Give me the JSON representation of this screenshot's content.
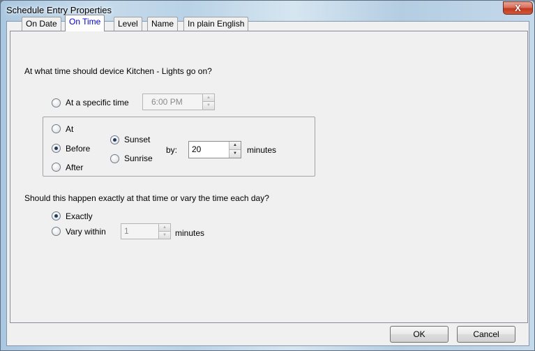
{
  "window": {
    "title": "Schedule Entry Properties",
    "close_glyph": "X"
  },
  "tabs": [
    {
      "label": "On Date",
      "active": false
    },
    {
      "label": "On Time",
      "active": true
    },
    {
      "label": "Level",
      "active": false
    },
    {
      "label": "Name",
      "active": false
    },
    {
      "label": "In plain English",
      "active": false
    }
  ],
  "on_time": {
    "question": "At what time should device Kitchen - Lights go on?",
    "specific_time": {
      "label": "At a specific time",
      "value": "6:00 PM",
      "selected": false,
      "enabled": false
    },
    "relative": {
      "timing_options": [
        {
          "label": "At",
          "selected": false
        },
        {
          "label": "Before",
          "selected": true
        },
        {
          "label": "After",
          "selected": false
        }
      ],
      "event_options": [
        {
          "label": "Sunset",
          "selected": true
        },
        {
          "label": "Sunrise",
          "selected": false
        }
      ],
      "by_label": "by:",
      "minutes_value": "20",
      "minutes_label": "minutes"
    },
    "variation_question": "Should this happen exactly at that time or vary the time each day?",
    "exactly": {
      "label": "Exactly",
      "selected": true
    },
    "vary": {
      "label": "Vary within",
      "value": "1",
      "selected": false,
      "enabled": false,
      "minutes_label": "minutes"
    }
  },
  "buttons": {
    "ok": "OK",
    "cancel": "Cancel"
  },
  "colors": {
    "active_tab_text": "#0000cc",
    "close_button": "#c0391f",
    "dialog_bg": "#f0f0f0"
  }
}
